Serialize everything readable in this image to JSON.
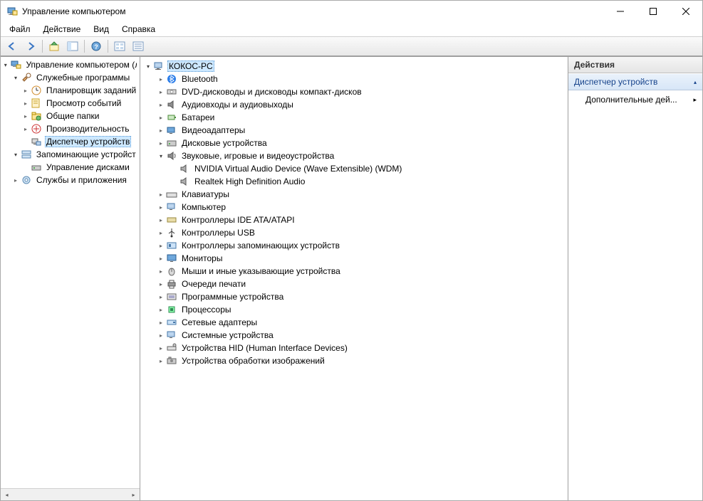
{
  "window": {
    "title": "Управление компьютером"
  },
  "menu": {
    "file": "Файл",
    "action": "Действие",
    "view": "Вид",
    "help": "Справка"
  },
  "leftTree": {
    "root": "Управление компьютером (л",
    "system_tools": "Служебные программы",
    "task_scheduler": "Планировщик заданий",
    "event_viewer": "Просмотр событий",
    "shared_folders": "Общие папки",
    "performance": "Производительность",
    "device_manager": "Диспетчер устройств",
    "storage": "Запоминающие устройст",
    "disk_mgmt": "Управление дисками",
    "services_apps": "Службы и приложения"
  },
  "centerTree": {
    "root": "КОКОС-PC",
    "bluetooth": "Bluetooth",
    "dvd": "DVD-дисководы и дисководы компакт-дисков",
    "audio_io": "Аудиовходы и аудиовыходы",
    "batteries": "Батареи",
    "video": "Видеоадаптеры",
    "disk": "Дисковые устройства",
    "sound_game_video": "Звуковые, игровые и видеоустройства",
    "nvidia_audio": "NVIDIA Virtual Audio Device (Wave Extensible) (WDM)",
    "realtek": "Realtek High Definition Audio",
    "keyboards": "Клавиатуры",
    "computer": "Компьютер",
    "ide": "Контроллеры IDE ATA/ATAPI",
    "usb": "Контроллеры USB",
    "storage_ctrl": "Контроллеры запоминающих устройств",
    "monitors": "Мониторы",
    "mice": "Мыши и иные указывающие устройства",
    "print_queues": "Очереди печати",
    "software_devices": "Программные устройства",
    "processors": "Процессоры",
    "network": "Сетевые адаптеры",
    "system_devices": "Системные устройства",
    "hid": "Устройства HID (Human Interface Devices)",
    "imaging": "Устройства обработки изображений"
  },
  "rightPane": {
    "header": "Действия",
    "section": "Диспетчер устройств",
    "more_actions": "Дополнительные дей..."
  }
}
